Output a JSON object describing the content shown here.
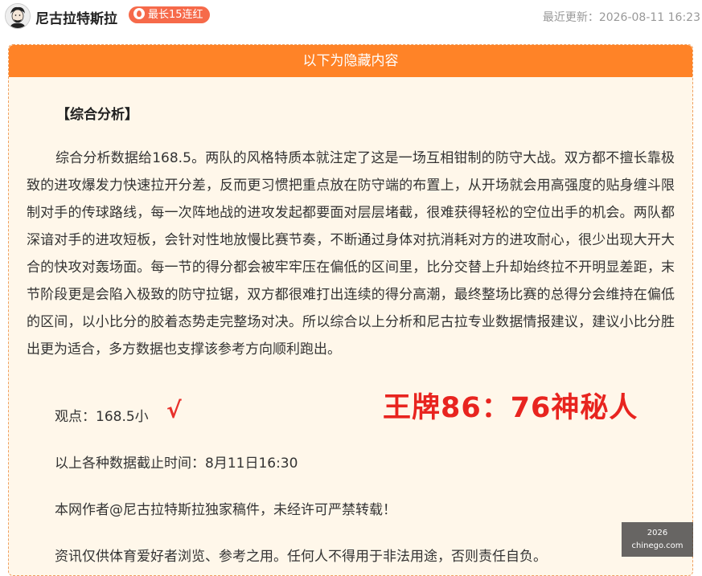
{
  "header": {
    "author": "尼古拉特斯拉",
    "streak_badge": "最长15连红",
    "updated_label": "最近更新：",
    "updated_time": "2026-08-11 16:23"
  },
  "hidden_box": {
    "title": "以下为隐藏内容",
    "section_title": "【综合分析】",
    "analysis": "综合分析数据给168.5。两队的风格特质本就注定了这是一场互相钳制的防守大战。双方都不擅长靠极致的进攻爆发力快速拉开分差，反而更习惯把重点放在防守端的布置上，从开场就会用高强度的贴身缠斗限制对手的传球路线，每一次阵地战的进攻发起都要面对层层堵截，很难获得轻松的空位出手的机会。两队都深谙对手的进攻短板，会针对性地放慢比赛节奏，不断通过身体对抗消耗对方的进攻耐心，很少出现大开大合的快攻对轰场面。每一节的得分都会被牢牢压在偏低的区间里，比分交替上升却始终拉不开明显差距，末节阶段更是会陷入极致的防守拉锯，双方都很难打出连续的得分高潮，最终整场比赛的总得分会维持在偏低的区间，以小比分的胶着态势走完整场对决。所以综合以上分析和尼古拉专业数据情报建议，建议小比分胜出更为适合，多方数据也支撑该参考方向顺利跑出。",
    "viewpoint": "观点：168.5小",
    "check_mark": "√",
    "final_score": "王牌86：76神秘人",
    "cutoff": "以上各种数据截止时间：8月11日16:30",
    "copyright": "本网作者@尼古拉特斯拉独家稿件，未经许可严禁转载！",
    "disclaimer": "资讯仅供体育爱好者浏览、参考之用。任何人不得用于非法用途，否则责任自负。"
  },
  "watermark": {
    "line1": "2026",
    "line2": "chinego.com"
  },
  "colors": {
    "accent": "#ff8327",
    "badge": "#f66a4a",
    "score_red": "#e8241f"
  }
}
